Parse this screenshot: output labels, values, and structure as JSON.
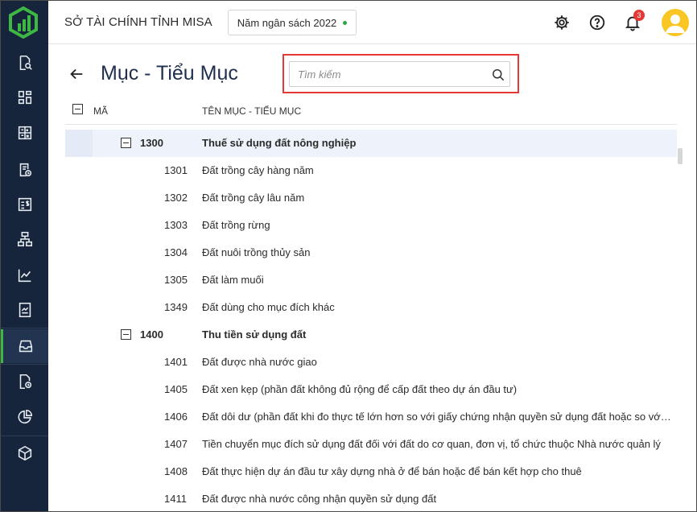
{
  "header": {
    "org_name": "SỞ TÀI CHÍNH TỈNH MISA",
    "fiscal_year": "Năm ngân sách 2022",
    "notification_count": "3"
  },
  "colors": {
    "sidebar_bg": "#16253b",
    "accent_green": "#3db843",
    "badge_red": "#e53935",
    "highlight_red": "#e53935",
    "avatar_yellow": "#f9c623",
    "title_navy": "#1f2f4d"
  },
  "sidebar": {
    "items": [
      {
        "icon": "search-document-icon"
      },
      {
        "icon": "dashboard-icon"
      },
      {
        "icon": "calculator-icon"
      },
      {
        "icon": "document-clock-icon"
      },
      {
        "icon": "currency-document-icon"
      },
      {
        "icon": "hierarchy-icon"
      },
      {
        "icon": "line-chart-icon"
      },
      {
        "icon": "report-icon"
      },
      {
        "icon": "inbox-icon",
        "active": true
      },
      {
        "icon": "file-clock-icon"
      },
      {
        "icon": "pie-chart-icon"
      },
      {
        "icon": "cube-icon"
      }
    ]
  },
  "page": {
    "title": "Mục - Tiểu Mục",
    "search_placeholder": "Tìm kiếm"
  },
  "grid": {
    "col_code": "MÃ",
    "col_name": "TÊN MỤC - TIỂU MỤC",
    "rows": [
      {
        "code": "1300",
        "name": "Thuế sử dụng đất nông nghiệp",
        "type": "group"
      },
      {
        "code": "1301",
        "name": "Đất trồng cây hàng năm",
        "type": "child"
      },
      {
        "code": "1302",
        "name": "Đất trồng cây lâu năm",
        "type": "child"
      },
      {
        "code": "1303",
        "name": "Đất trồng rừng",
        "type": "child"
      },
      {
        "code": "1304",
        "name": "Đất nuôi trồng thủy sản",
        "type": "child"
      },
      {
        "code": "1305",
        "name": "Đất làm muối",
        "type": "child"
      },
      {
        "code": "1349",
        "name": "Đất dùng cho mục đích khác",
        "type": "child"
      },
      {
        "code": "1400",
        "name": "Thu tiền sử dụng đất",
        "type": "group"
      },
      {
        "code": "1401",
        "name": "Đất được nhà nước giao",
        "type": "child"
      },
      {
        "code": "1405",
        "name": "Đất xen kẹp (phần đất không đủ rộng để cấp đất theo dự án đầu tư)",
        "type": "child"
      },
      {
        "code": "1406",
        "name": "Đất dôi dư (phần đất khi đo thực tế lớn hơn so với giấy chứng nhận quyền sử dụng đất hoặc so với d...",
        "type": "child"
      },
      {
        "code": "1407",
        "name": "Tiền chuyển mục đích sử dụng đất đối với đất do cơ quan, đơn vị, tổ chức thuộc Nhà nước quản lý",
        "type": "child"
      },
      {
        "code": "1408",
        "name": "Đất thực hiện dự án đầu tư xây dựng nhà ở để bán hoặc để bán kết hợp cho thuê",
        "type": "child"
      },
      {
        "code": "1411",
        "name": "Đất được nhà nước công nhận quyền sử dụng đất",
        "type": "child"
      }
    ]
  }
}
